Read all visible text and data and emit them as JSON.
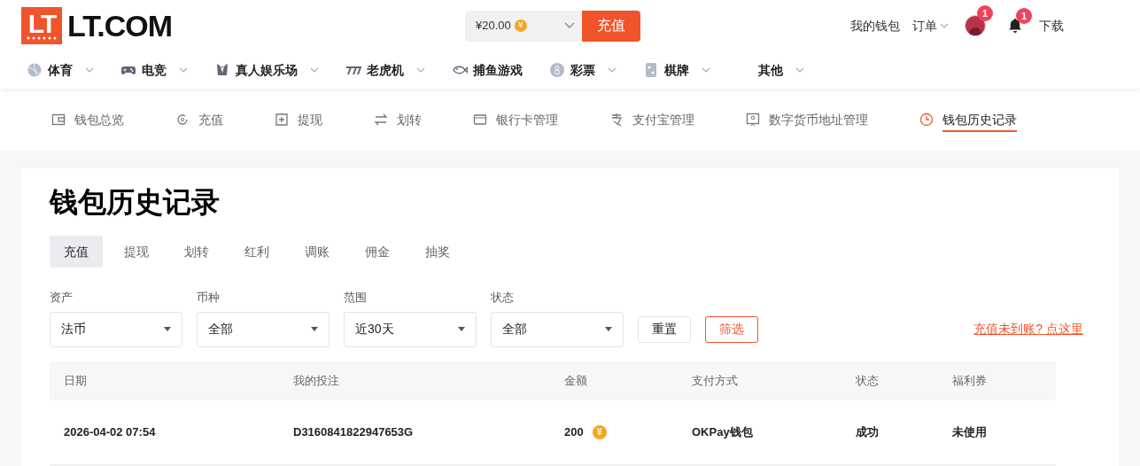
{
  "logo": {
    "mark": "LT",
    "text": "LT.COM"
  },
  "balance": {
    "amount": "¥20.00",
    "coin": "¥"
  },
  "deposit_button": "充值",
  "top_links": [
    {
      "label": "我的钱包",
      "dropdown": false
    },
    {
      "label": "订单",
      "dropdown": true
    }
  ],
  "avatar_badge": "1",
  "bell_badge": "1",
  "download_link": "下载",
  "nav": [
    {
      "label": "体育",
      "dropdown": true
    },
    {
      "label": "电竞",
      "dropdown": true
    },
    {
      "label": "真人娱乐场",
      "dropdown": true
    },
    {
      "label": "老虎机",
      "dropdown": true
    },
    {
      "label": "捕鱼游戏",
      "dropdown": false
    },
    {
      "label": "彩票",
      "dropdown": true
    },
    {
      "label": "棋牌",
      "dropdown": true
    },
    {
      "label": "其他",
      "dropdown": true
    }
  ],
  "wallet_menu": [
    {
      "label": "钱包总览",
      "selected": false
    },
    {
      "label": "充值",
      "selected": false
    },
    {
      "label": "提现",
      "selected": false
    },
    {
      "label": "划转",
      "selected": false
    },
    {
      "label": "银行卡管理",
      "selected": false
    },
    {
      "label": "支付宝管理",
      "selected": false
    },
    {
      "label": "数字货币地址管理",
      "selected": false
    },
    {
      "label": "钱包历史记录",
      "selected": true
    }
  ],
  "page_title": "钱包历史记录",
  "record_tabs": [
    {
      "label": "充值",
      "selected": true
    },
    {
      "label": "提现",
      "selected": false
    },
    {
      "label": "划转",
      "selected": false
    },
    {
      "label": "红利",
      "selected": false
    },
    {
      "label": "调账",
      "selected": false
    },
    {
      "label": "佣金",
      "selected": false
    },
    {
      "label": "抽奖",
      "selected": false
    }
  ],
  "filters": [
    {
      "label": "资产",
      "value": "法币"
    },
    {
      "label": "币种",
      "value": "全部"
    },
    {
      "label": "范围",
      "value": "近30天"
    },
    {
      "label": "状态",
      "value": "全部"
    }
  ],
  "reset_button": "重置",
  "filter_button": "筛选",
  "help_link": "充值未到账? 点这里",
  "table": {
    "columns": [
      "日期",
      "我的投注",
      "金额",
      "支付方式",
      "状态",
      "福利券"
    ],
    "rows": [
      {
        "date": "2026-04-02 07:54",
        "bet": "D3160841822947653G",
        "amount": "200",
        "coin": "¥",
        "payment": "OKPay钱包",
        "status": "成功",
        "coupon": "未使用"
      }
    ]
  }
}
